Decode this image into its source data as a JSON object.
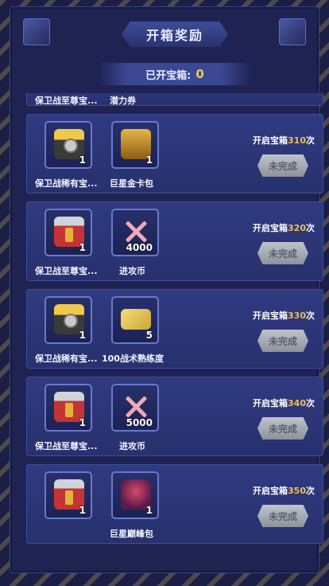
{
  "header": {
    "title": "开箱奖励",
    "opened_label": "已开宝箱:",
    "opened_count": "0"
  },
  "partial_row": {
    "item1_name": "保卫战至尊宝...",
    "item2_name": "潜力券"
  },
  "rows": [
    {
      "item1": {
        "name": "保卫战稀有宝...",
        "qty": "1",
        "icon": "gold-chest-icon"
      },
      "item2": {
        "name": "巨星金卡包",
        "qty": "1",
        "icon": "gold-card-pack-icon"
      },
      "req_prefix": "开启宝箱",
      "req_num": "310",
      "req_suffix": "次",
      "button": "未完成"
    },
    {
      "item1": {
        "name": "保卫战至尊宝...",
        "qty": "1",
        "icon": "red-chest-icon"
      },
      "item2": {
        "name": "进攻币",
        "qty": "4000",
        "icon": "crossed-swords-icon"
      },
      "req_prefix": "开启宝箱",
      "req_num": "320",
      "req_suffix": "次",
      "button": "未完成"
    },
    {
      "item1": {
        "name": "保卫战稀有宝...",
        "qty": "1",
        "icon": "gold-chest-icon"
      },
      "item2": {
        "name": "100战术熟练度",
        "qty": "5",
        "icon": "tactic-ticket-icon"
      },
      "req_prefix": "开启宝箱",
      "req_num": "330",
      "req_suffix": "次",
      "button": "未完成"
    },
    {
      "item1": {
        "name": "保卫战至尊宝...",
        "qty": "1",
        "icon": "red-chest-icon"
      },
      "item2": {
        "name": "进攻币",
        "qty": "5000",
        "icon": "crossed-swords-icon"
      },
      "req_prefix": "开启宝箱",
      "req_num": "340",
      "req_suffix": "次",
      "button": "未完成"
    },
    {
      "item1": {
        "name": "",
        "qty": "1",
        "icon": "red-chest-icon"
      },
      "item2": {
        "name": "巨星巅峰包",
        "qty": "1",
        "icon": "star-pack-icon"
      },
      "req_prefix": "开启宝箱",
      "req_num": "350",
      "req_suffix": "次",
      "button": "未完成"
    }
  ]
}
